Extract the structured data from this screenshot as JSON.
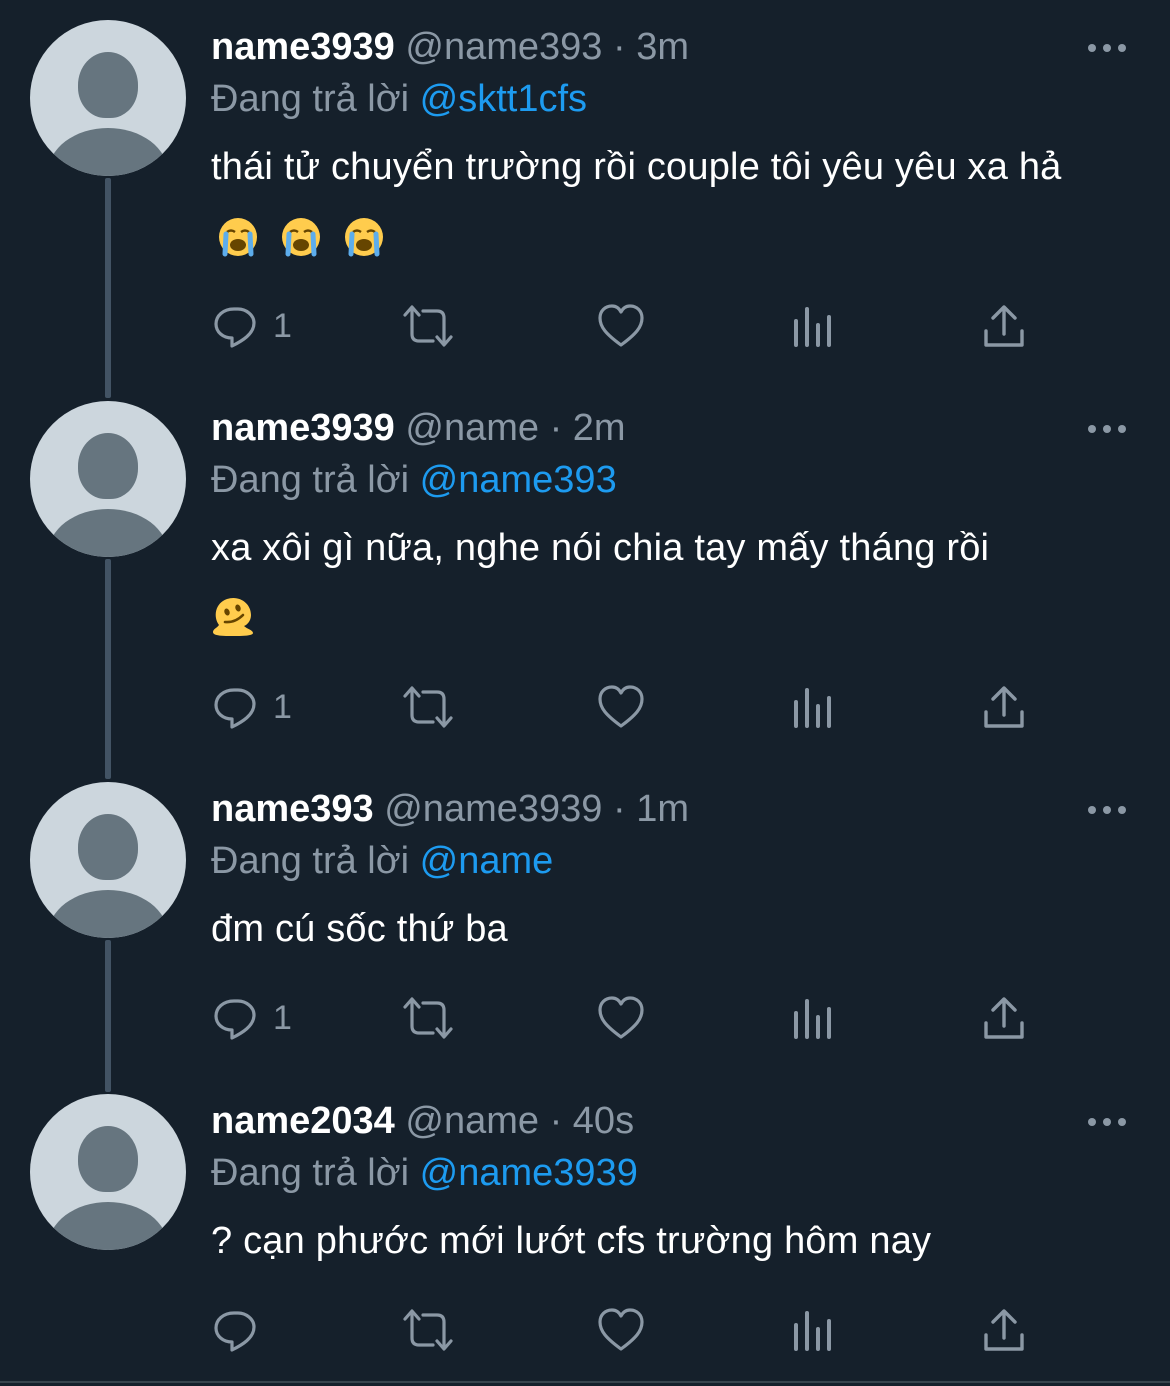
{
  "colors": {
    "background": "#15202b",
    "primary_text": "#ffffff",
    "secondary_text": "#8b98a5",
    "link": "#1d9bf0",
    "thread_line": "#425364",
    "avatar_bg": "#ccd6dd",
    "avatar_fg": "#66757f"
  },
  "reply_prefix": "Đang trả lời",
  "tweets": [
    {
      "display_name": "name3939",
      "handle": "@name393",
      "separator": "·",
      "time": "3m",
      "reply_to": "@sktt1cfs",
      "text": "thái tử chuyển trường rồi couple tôi yêu yêu xa hả",
      "emojis": [
        "loudly-crying-face",
        "loudly-crying-face",
        "loudly-crying-face"
      ],
      "reply_count": "1"
    },
    {
      "display_name": "name3939",
      "handle": "@name",
      "separator": "·",
      "time": "2m",
      "reply_to": "@name393",
      "text": "xa xôi gì nữa, nghe nói chia tay mấy tháng rồi",
      "emojis": [
        "melting-face"
      ],
      "reply_count": "1"
    },
    {
      "display_name": "name393",
      "handle": "@name3939",
      "separator": "·",
      "time": "1m",
      "reply_to": "@name",
      "text": "đm cú sốc thứ ba",
      "emojis": [],
      "reply_count": "1"
    },
    {
      "display_name": "name2034",
      "handle": "@name",
      "separator": "·",
      "time": "40s",
      "reply_to": "@name3939",
      "text": "? cạn phước mới lướt cfs trường hôm nay",
      "emojis": [],
      "reply_count": ""
    }
  ],
  "action_icons": [
    "reply-icon",
    "retweet-icon",
    "like-icon",
    "views-icon",
    "share-icon"
  ]
}
